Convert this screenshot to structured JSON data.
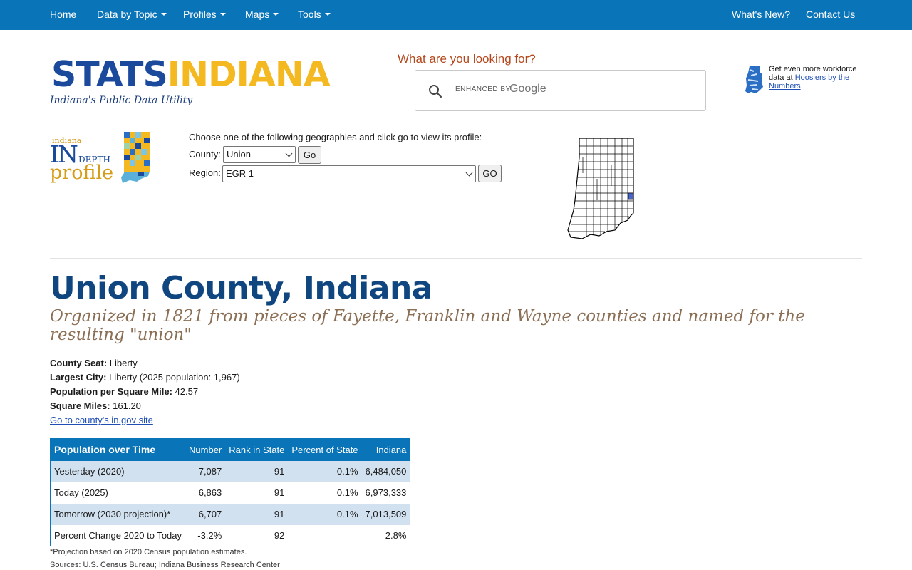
{
  "nav": {
    "left": [
      {
        "label": "Home",
        "dropdown": false
      },
      {
        "label": "Data by Topic",
        "dropdown": true
      },
      {
        "label": "Profiles",
        "dropdown": true
      },
      {
        "label": "Maps",
        "dropdown": true
      },
      {
        "label": "Tools",
        "dropdown": true
      }
    ],
    "right": [
      {
        "label": "What's New?"
      },
      {
        "label": "Contact Us"
      }
    ]
  },
  "logo": {
    "stats": "STATS",
    "indiana": "INDIANA",
    "tagline": "Indiana's Public Data Utility"
  },
  "search": {
    "heading": "What are you looking for?",
    "enhanced_by": "ENHANCED BY",
    "provider": "Google"
  },
  "promo": {
    "text": "Get even more workforce data at ",
    "link": "Hoosiers by the Numbers"
  },
  "indepth_logo": {
    "small": "indiana",
    "in": "IN",
    "depth": "DEPTH",
    "profile": "profile"
  },
  "geography": {
    "prompt": "Choose one of the following geographies and click go to view its profile:",
    "county_label": "County:",
    "county_value": "Union",
    "county_button": "Go",
    "region_label": "Region:",
    "region_value": "EGR 1",
    "region_button": "GO"
  },
  "county": {
    "title": "Union County, Indiana",
    "subtitle": "Organized in 1821 from pieces of Fayette, Franklin and Wayne counties and named for the resulting \"union\"",
    "facts": [
      {
        "label": "County Seat:",
        "value": " Liberty"
      },
      {
        "label": "Largest City:",
        "value": " Liberty (2025 population: 1,967)"
      },
      {
        "label": "Population per Square Mile:",
        "value": " 42.57"
      },
      {
        "label": "Square Miles:",
        "value": " 161.20"
      }
    ],
    "link": "Go to county's in.gov site"
  },
  "population_table": {
    "headers": [
      "Population over Time",
      "Number",
      "Rank in State",
      "Percent of State",
      "Indiana"
    ],
    "rows": [
      [
        "Yesterday (2020)",
        "7,087",
        "91",
        "0.1%",
        "6,484,050"
      ],
      [
        "Today (2025)",
        "6,863",
        "91",
        "0.1%",
        "6,973,333"
      ],
      [
        "Tomorrow (2030 projection)*",
        "6,707",
        "91",
        "0.1%",
        "7,013,509"
      ],
      [
        "Percent Change 2020 to Today",
        "-3.2%",
        "92",
        "",
        "2.8%"
      ]
    ],
    "footnote": "*Projection based on 2020 Census population estimates.",
    "sources": "Sources: U.S. Census Bureau; Indiana Business Research Center"
  },
  "colors": {
    "nav_bg": "#0a74b8",
    "brand_blue": "#1b4a9c",
    "brand_gold": "#f4b921",
    "title_blue": "#10467f",
    "alt_row": "#d1e1f0"
  }
}
